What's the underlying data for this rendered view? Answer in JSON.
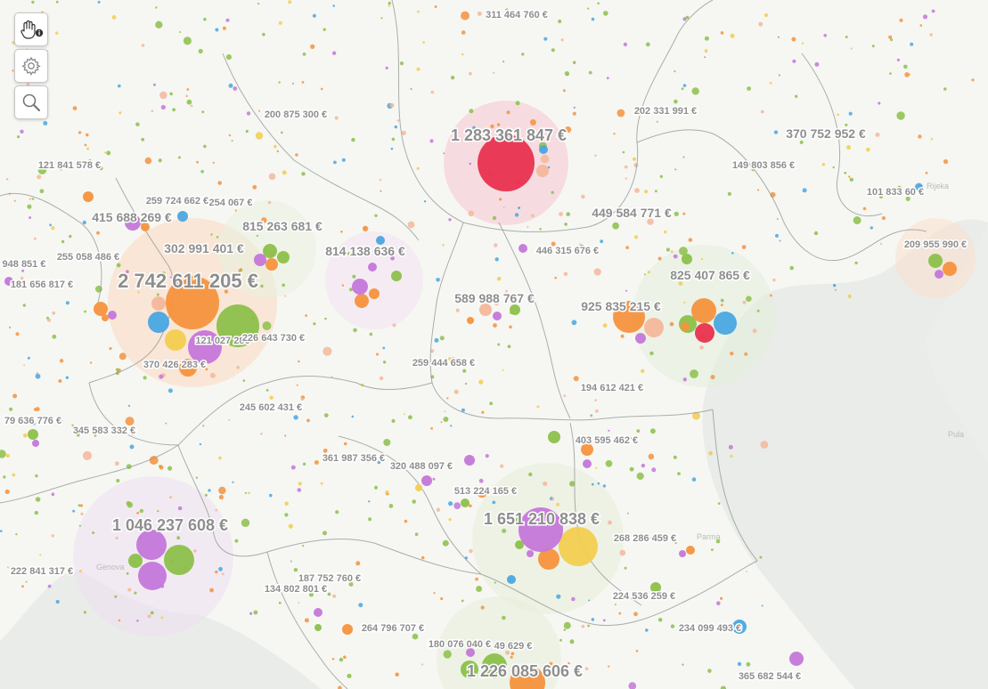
{
  "map": {
    "palette": {
      "red": "#e8324f",
      "orange": "#f5923d",
      "green": "#8cc04a",
      "purple": "#c477d9",
      "blue": "#4aa6e0",
      "peach": "#f4b79a",
      "yellow": "#f2cd4f",
      "border": "#8f9692",
      "land": "#f6f7f3",
      "sea": "#e9ece9"
    },
    "controls": [
      {
        "id": "pan-info",
        "icon": "hand-info-icon"
      },
      {
        "id": "settings",
        "icon": "gear-icon"
      },
      {
        "id": "search",
        "icon": "search-icon"
      }
    ],
    "place_names": [
      "Genova",
      "Parma",
      "Rijeka",
      "Pula"
    ],
    "labels": [
      {
        "text": "311 464 760 €",
        "size": "small"
      },
      {
        "text": "200 875 300 €",
        "size": "small"
      },
      {
        "text": "202 331 991 €",
        "size": "small"
      },
      {
        "text": "370 752 952 €",
        "size": "medium"
      },
      {
        "text": "1 283 361 847 €",
        "size": "large"
      },
      {
        "text": "121 841 578 €",
        "size": "small"
      },
      {
        "text": "149 803 856 €",
        "size": "small"
      },
      {
        "text": "101 833 60 €",
        "size": "small"
      },
      {
        "text": "259 724 662 €",
        "size": "small"
      },
      {
        "text": "254 067 €",
        "size": "small"
      },
      {
        "text": "415 688 269 €",
        "size": "medium"
      },
      {
        "text": "815 263 681 €",
        "size": "medium"
      },
      {
        "text": "449 584 771 €",
        "size": "medium"
      },
      {
        "text": "302 991 401 €",
        "size": "medium"
      },
      {
        "text": "814 138 636 €",
        "size": "medium"
      },
      {
        "text": "446 315 676 €",
        "size": "small"
      },
      {
        "text": "209 955 990 €",
        "size": "small"
      },
      {
        "text": "255 058 486 €",
        "size": "small"
      },
      {
        "text": "948 851 €",
        "size": "small"
      },
      {
        "text": "181 656 817 €",
        "size": "small"
      },
      {
        "text": "2 742 611 205 €",
        "size": "xlarge"
      },
      {
        "text": "825 407 865 €",
        "size": "medium"
      },
      {
        "text": "589 988 767 €",
        "size": "medium"
      },
      {
        "text": "925 835 215 €",
        "size": "medium"
      },
      {
        "text": "121 027 286",
        "size": "small"
      },
      {
        "text": "226 643 730 €",
        "size": "small"
      },
      {
        "text": "370 426 283 €",
        "size": "small"
      },
      {
        "text": "259 444 658 €",
        "size": "small"
      },
      {
        "text": "194 612 421 €",
        "size": "small"
      },
      {
        "text": "245 602 431 €",
        "size": "small"
      },
      {
        "text": "79 636 776 €",
        "size": "small"
      },
      {
        "text": "345 583 332 €",
        "size": "small"
      },
      {
        "text": "403 595 462 €",
        "size": "small"
      },
      {
        "text": "361 987 356 €",
        "size": "small"
      },
      {
        "text": "320 488 097 €",
        "size": "small"
      },
      {
        "text": "513 224 165 €",
        "size": "small"
      },
      {
        "text": "1 651 210 838 €",
        "size": "large"
      },
      {
        "text": "1 046 237 608 €",
        "size": "large"
      },
      {
        "text": "268 286 459 €",
        "size": "small"
      },
      {
        "text": "222 841 317 €",
        "size": "small"
      },
      {
        "text": "187 752 760 €",
        "size": "small"
      },
      {
        "text": "134 802 801 €",
        "size": "small"
      },
      {
        "text": "224 536 259 €",
        "size": "small"
      },
      {
        "text": "264 796 707 €",
        "size": "small"
      },
      {
        "text": "234 099 493 €",
        "size": "small"
      },
      {
        "text": "180 076 040 €",
        "size": "small"
      },
      {
        "text": "49 629 €",
        "size": "small"
      },
      {
        "text": "1 226 085 606 €",
        "size": "large"
      },
      {
        "text": "365 682 544 €",
        "size": "small"
      }
    ],
    "bubbles": [
      {
        "color": "red"
      },
      {
        "color": "peach"
      },
      {
        "color": "blue"
      },
      {
        "color": "orange"
      },
      {
        "color": "green"
      },
      {
        "color": "purple"
      },
      {
        "color": "blue"
      },
      {
        "color": "yellow"
      },
      {
        "color": "orange"
      },
      {
        "color": "peach"
      },
      {
        "color": "purple"
      },
      {
        "color": "green"
      },
      {
        "color": "orange"
      },
      {
        "color": "purple"
      },
      {
        "color": "green"
      },
      {
        "color": "blue"
      },
      {
        "color": "orange"
      },
      {
        "color": "orange"
      },
      {
        "color": "purple"
      },
      {
        "color": "blue"
      },
      {
        "color": "orange"
      },
      {
        "color": "green"
      },
      {
        "color": "purple"
      },
      {
        "color": "orange"
      },
      {
        "color": "peach"
      },
      {
        "color": "green"
      },
      {
        "color": "red"
      },
      {
        "color": "purple"
      },
      {
        "color": "orange"
      },
      {
        "color": "blue"
      },
      {
        "color": "orange"
      },
      {
        "color": "green"
      },
      {
        "color": "purple"
      },
      {
        "color": "green"
      },
      {
        "color": "orange"
      },
      {
        "color": "purple"
      },
      {
        "color": "peach"
      },
      {
        "color": "purple"
      },
      {
        "color": "green"
      },
      {
        "color": "orange"
      },
      {
        "color": "yellow"
      },
      {
        "color": "orange"
      },
      {
        "color": "purple"
      },
      {
        "color": "green"
      },
      {
        "color": "purple"
      },
      {
        "color": "green"
      },
      {
        "color": "orange"
      },
      {
        "color": "purple"
      },
      {
        "color": "blue"
      },
      {
        "color": "purple"
      },
      {
        "color": "purple"
      },
      {
        "color": "orange"
      },
      {
        "color": "green"
      },
      {
        "color": "yellow"
      },
      {
        "color": "purple"
      },
      {
        "color": "green"
      },
      {
        "color": "purple"
      },
      {
        "color": "green"
      }
    ]
  }
}
